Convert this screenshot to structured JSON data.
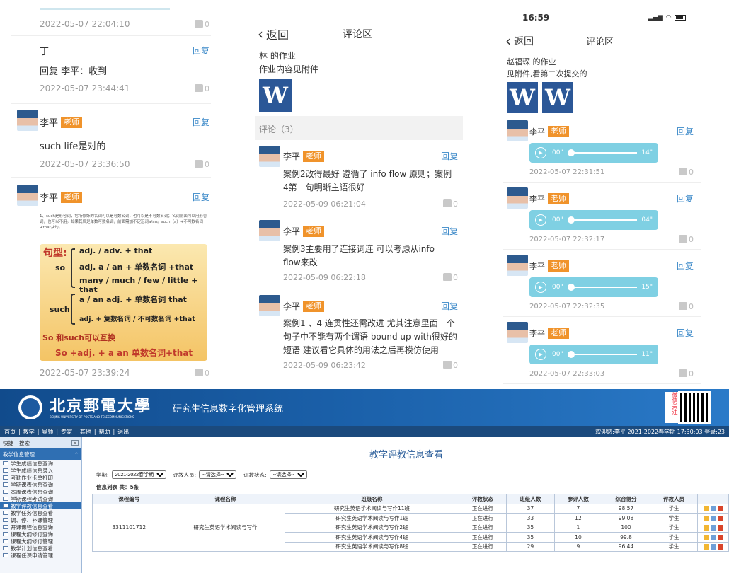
{
  "p1": {
    "top_time": "2022-05-07 22:04:10",
    "top_likes": "0",
    "c1": {
      "name": "丁",
      "reply": "回复",
      "text": "回复 李平：收到",
      "time": "2022-05-07 23:44:41",
      "likes": "0"
    },
    "c2": {
      "name": "李平",
      "tag": "老师",
      "reply": "回复",
      "text": "such life是对的",
      "time": "2022-05-07 23:36:50",
      "likes": "0"
    },
    "c3": {
      "name": "李平",
      "tag": "老师",
      "reply": "回复",
      "small": "1、such是形容词，它所修饰的名词可以是可数名词，也可以是不可数名词；名词前面可以用形容词，也可以不用。如果其后是单数可数名词，前面需加不定冠词a/an。such（a）+不可数名词+that从句。",
      "grammar": {
        "head": "句型:",
        "so": "so",
        "so1": "adj. / adv. + that",
        "so2": "adj. a / an + 单数名词 +that",
        "so3": "many / much / few / little + that",
        "such": "such",
        "such1": "a / an adj. + 单数名词 that",
        "such2": "adj. + 复数名词 / 不可数名词 +that",
        "swap": "So 和such可以互换",
        "rule": "So +adj. + a an 单数名词+that"
      },
      "time": "2022-05-07 23:39:24",
      "likes": "0"
    }
  },
  "p2": {
    "back": "返回",
    "title": "评论区",
    "owner": "林",
    "owner_suffix": " 的作业",
    "desc": "作业内容见附件",
    "w": "W",
    "count": "评论（3）",
    "comments": [
      {
        "name": "李平",
        "tag": "老师",
        "reply": "回复",
        "text": "案例2改得最好 遵循了 info flow 原则；案例4第一句明晰主语很好",
        "time": "2022-05-09 06:21:04",
        "likes": "0"
      },
      {
        "name": "李平",
        "tag": "老师",
        "reply": "回复",
        "text": "案例3主要用了连接词连 可以考虑从info flow来改",
        "time": "2022-05-09 06:22:18",
        "likes": "0"
      },
      {
        "name": "李平",
        "tag": "老师",
        "reply": "回复",
        "text": "案例1 、4 连贯性还需改进 尤其注意里面一个句子中不能有两个谓语 bound up with很好的短语 建议看它具体的用法之后再模仿使用",
        "time": "2022-05-09 06:23:42",
        "likes": "0"
      }
    ]
  },
  "p3": {
    "clock": "16:59",
    "back": "返回",
    "title": "评论区",
    "owner": "赵福琛 的作业",
    "desc": "见附件,看第二次提交的",
    "w": "W",
    "comments": [
      {
        "name": "李平",
        "tag": "老师",
        "reply": "回复",
        "start": "00\"",
        "dur": "14\"",
        "time": "2022-05-07 22:31:51",
        "likes": "0"
      },
      {
        "name": "李平",
        "tag": "老师",
        "reply": "回复",
        "start": "00\"",
        "dur": "04\"",
        "time": "2022-05-07 22:32:17",
        "likes": "0"
      },
      {
        "name": "李平",
        "tag": "老师",
        "reply": "回复",
        "start": "00\"",
        "dur": "15\"",
        "time": "2022-05-07 22:32:35",
        "likes": "0"
      },
      {
        "name": "李平",
        "tag": "老师",
        "reply": "回复",
        "start": "00\"",
        "dur": "11\"",
        "time": "2022-05-07 22:33:03",
        "likes": "0"
      }
    ]
  },
  "sys": {
    "univ": "北京郵電大學",
    "univ_en": "BEIJING UNIVERSITY OF POSTS AND TELECOMMUNICATIONS",
    "system": "研究生信息数字化管理系统",
    "wechat": "微信关注",
    "nav": [
      "首页",
      "教学",
      "导师",
      "专家",
      "其他",
      "帮助",
      "退出"
    ],
    "welcome": "欢迎您:李平  2021-2022春学期    17:30:03  登录:23",
    "side_tabs": [
      "快捷",
      "搜索"
    ],
    "side_title": "教学信息管理",
    "side_items": [
      "学生成绩信息查询",
      "学生成绩信息录入",
      "考勤作业卡单打印",
      "学期课表信息查询",
      "本周课表信息查询",
      "学期课程考试查询",
      "教学评教信息查看",
      "教学任务信息查看",
      "调、停、补课管理",
      "开课课程信息查询",
      "课程大纲修订查询",
      "课程大纲修订管理",
      "教学计划信息查看",
      "课程任课申请管理"
    ],
    "page_title": "教学评教信息查看",
    "f_term_label": "学期:",
    "f_term": "2021-2022春学期",
    "f_who_label": "评教人员:",
    "f_who": "--请选择--",
    "f_state_label": "评教状态:",
    "f_state": "--请选择--",
    "list_label": "信息列表 共：5条",
    "headers": [
      "课程编号",
      "课程名称",
      "班级名称",
      "评教状态",
      "班级人数",
      "参评人数",
      "综合得分",
      "评教人员"
    ],
    "course_no": "3311101712",
    "course_name": "研究生英语学术阅读与写作",
    "rows": [
      [
        "研究生英语学术阅读与写作11班",
        "正在进行",
        "37",
        "7",
        "98.57",
        "学生"
      ],
      [
        "研究生英语学术阅读与写作1班",
        "正在进行",
        "33",
        "12",
        "99.08",
        "学生"
      ],
      [
        "研究生英语学术阅读与写作2班",
        "正在进行",
        "35",
        "1",
        "100",
        "学生"
      ],
      [
        "研究生英语学术阅读与写作4班",
        "正在进行",
        "35",
        "10",
        "99.8",
        "学生"
      ],
      [
        "研究生英语学术阅读与写作8班",
        "正在进行",
        "29",
        "9",
        "96.44",
        "学生"
      ]
    ]
  }
}
